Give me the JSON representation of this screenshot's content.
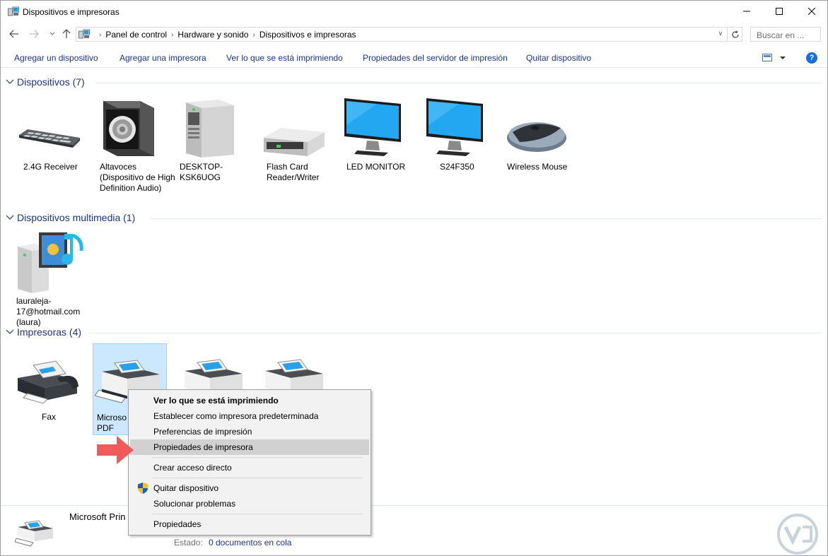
{
  "window": {
    "title": "Dispositivos e impresoras"
  },
  "address": {
    "crumbs": [
      "Panel de control",
      "Hardware y sonido",
      "Dispositivos e impresoras"
    ],
    "search_placeholder": "Buscar en ..."
  },
  "commands": {
    "add_device": "Agregar un dispositivo",
    "add_printer": "Agregar una impresora",
    "see_printing": "Ver lo que se está imprimiendo",
    "server_props": "Propiedades del servidor de impresión",
    "remove_device": "Quitar dispositivo"
  },
  "groups": {
    "devices": {
      "title": "Dispositivos (7)",
      "items": [
        {
          "label": "2.4G Receiver",
          "icon": "keyboard-icon"
        },
        {
          "label": "Altavoces (Dispositivo de High Definition Audio)",
          "icon": "speaker-icon"
        },
        {
          "label": "DESKTOP-KSK6UOG",
          "icon": "computer-tower-icon"
        },
        {
          "label": "Flash Card Reader/Writer",
          "icon": "drive-icon"
        },
        {
          "label": "LED MONITOR",
          "icon": "monitor-icon"
        },
        {
          "label": "S24F350",
          "icon": "monitor-icon"
        },
        {
          "label": "Wireless Mouse",
          "icon": "mouse-icon"
        }
      ]
    },
    "multimedia": {
      "title": "Dispositivos multimedia (1)",
      "items": [
        {
          "label": "lauraleja-17@hotmail.com (laura)",
          "icon": "media-server-icon"
        }
      ]
    },
    "printers": {
      "title": "Impresoras (4)",
      "items": [
        {
          "label": "Fax",
          "icon": "fax-icon"
        },
        {
          "label": "Microsoft Print to PDF",
          "label_visible": "Microso",
          "label_line2": "PDF",
          "icon": "printer-icon"
        },
        {
          "label": "",
          "icon": "printer-icon"
        },
        {
          "label": "",
          "icon": "printer-icon"
        }
      ]
    }
  },
  "context_menu": {
    "items": [
      "Ver lo que se está imprimiendo",
      "Establecer como impresora predeterminada",
      "Preferencias de impresión",
      "Propiedades de impresora",
      "Crear acceso directo",
      "Quitar dispositivo",
      "Solucionar problemas",
      "Propiedades"
    ],
    "highlighted_index": 3
  },
  "details": {
    "name": "Microsoft Prin",
    "state_label": "Estado:",
    "state_value": "0 documentos en cola"
  },
  "colors": {
    "link_blue": "#1e3287",
    "selection": "#cce8ff",
    "arrow_red": "#f05a5a"
  }
}
